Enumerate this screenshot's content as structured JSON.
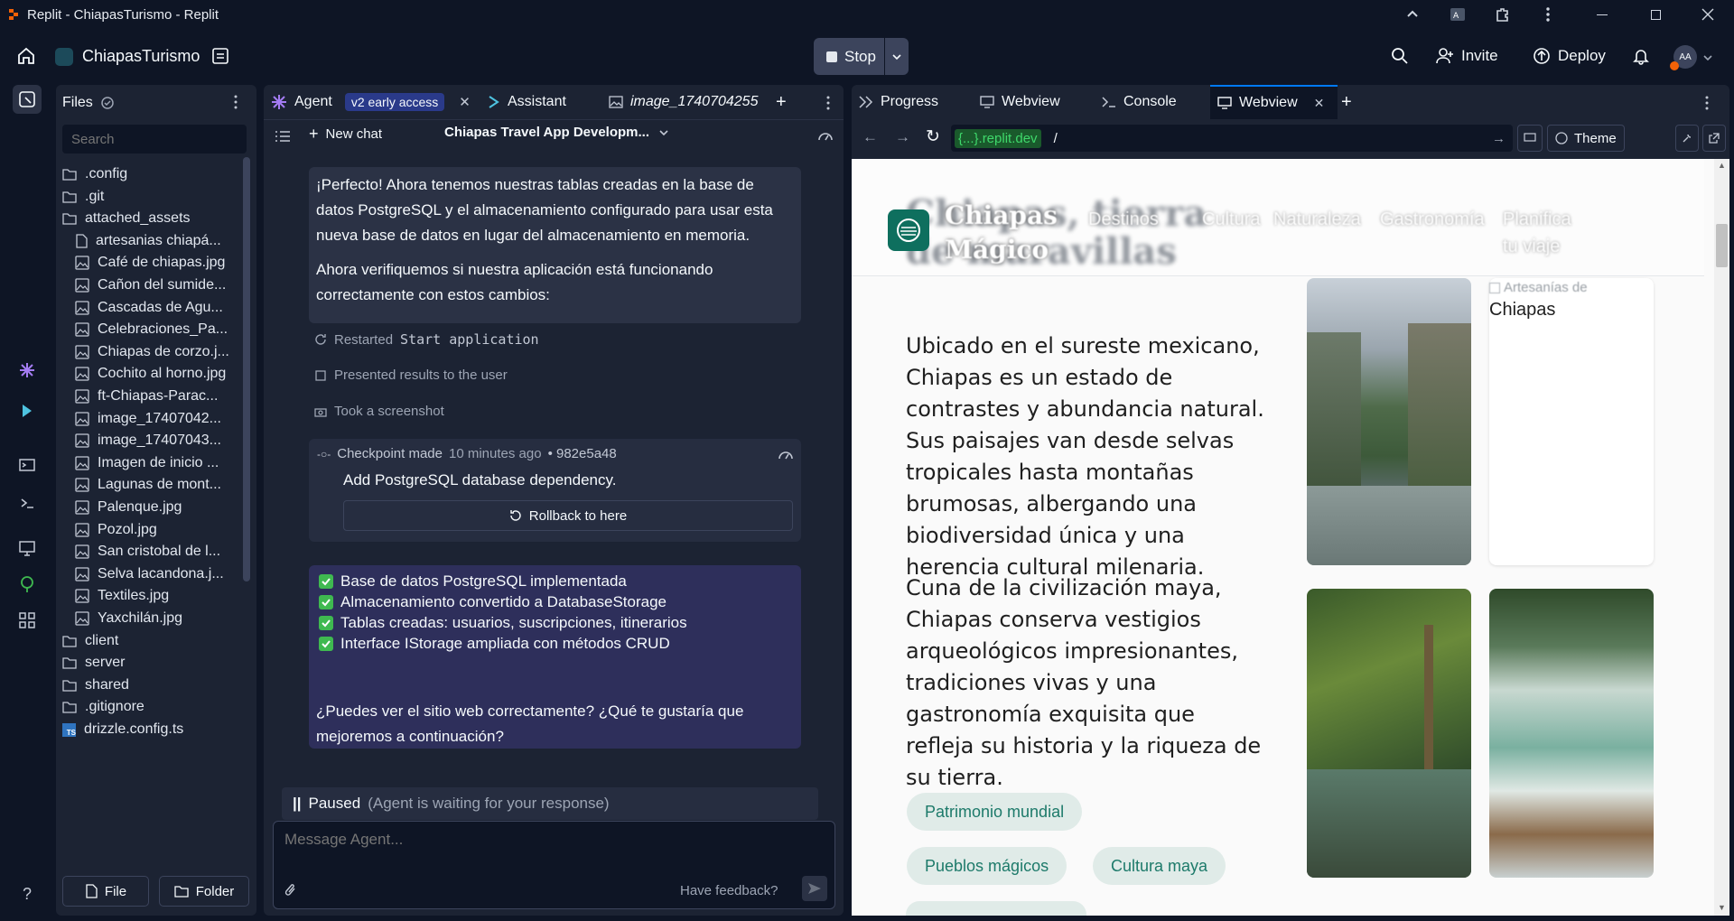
{
  "window": {
    "title": "Replit - ChiapasTurismo - Replit"
  },
  "topbar": {
    "project": "ChiapasTurismo",
    "stop": "Stop",
    "invite": "Invite",
    "deploy": "Deploy",
    "avatar": "AA"
  },
  "files": {
    "title": "Files",
    "search_placeholder": "Search",
    "items": [
      {
        "name": ".config",
        "type": "folder"
      },
      {
        "name": ".git",
        "type": "folder"
      },
      {
        "name": "attached_assets",
        "type": "folder-open"
      },
      {
        "name": "artesanias chiapá...",
        "type": "file"
      },
      {
        "name": "Café de chiapas.jpg",
        "type": "image"
      },
      {
        "name": "Cañon del sumide...",
        "type": "image"
      },
      {
        "name": "Cascadas de Agu...",
        "type": "image"
      },
      {
        "name": "Celebraciones_Pa...",
        "type": "image"
      },
      {
        "name": "Chiapas de corzo.j...",
        "type": "image"
      },
      {
        "name": "Cochito al horno.jpg",
        "type": "image"
      },
      {
        "name": "ft-Chiapas-Parac...",
        "type": "image"
      },
      {
        "name": "image_17407042...",
        "type": "image"
      },
      {
        "name": "image_17407043...",
        "type": "image"
      },
      {
        "name": "Imagen de inicio ...",
        "type": "image"
      },
      {
        "name": "Lagunas de mont...",
        "type": "image"
      },
      {
        "name": "Palenque.jpg",
        "type": "image"
      },
      {
        "name": "Pozol.jpg",
        "type": "image"
      },
      {
        "name": "San cristobal de l...",
        "type": "image"
      },
      {
        "name": "Selva lacandona.j...",
        "type": "image"
      },
      {
        "name": "Textiles.jpg",
        "type": "image"
      },
      {
        "name": "Yaxchilán.jpg",
        "type": "image"
      },
      {
        "name": "client",
        "type": "folder"
      },
      {
        "name": "server",
        "type": "folder"
      },
      {
        "name": "shared",
        "type": "folder"
      },
      {
        "name": ".gitignore",
        "type": "folder"
      },
      {
        "name": "drizzle.config.ts",
        "type": "ts"
      }
    ],
    "new_file": "File",
    "new_folder": "Folder"
  },
  "agent": {
    "tab_agent": "Agent",
    "badge": "v2 early access",
    "tab_assistant": "Assistant",
    "tab_image": "image_1740704255",
    "new_chat": "New chat",
    "chat_title": "Chiapas Travel App Developm...",
    "msg1": "¡Perfecto! Ahora tenemos nuestras tablas creadas en la base de datos PostgreSQL y el almacenamiento configurado para usar esta nueva base de datos en lugar del almacenamiento en memoria.",
    "msg2": "Ahora verifiquemos si nuestra aplicación está funcionando correctamente con estos cambios:",
    "act1_prefix": "Restarted",
    "act1_code": "Start application",
    "act2": "Presented results to the user",
    "act3": "Took a screenshot",
    "checkpoint_label": "Checkpoint made",
    "checkpoint_time": "10 minutes ago",
    "checkpoint_hash": "• 982e5a48",
    "checkpoint_desc": "Add PostgreSQL database dependency.",
    "rollback": "Rollback to here",
    "checks": [
      "Base de datos PostgreSQL implementada",
      "Almacenamiento convertido a DatabaseStorage",
      "Tablas creadas: usuarios, suscripciones, itinerarios",
      "Interface IStorage ampliada con métodos CRUD"
    ],
    "question": "¿Puedes ver el sitio web correctamente? ¿Qué te gustaría que mejoremos a continuación?",
    "paused": "Paused",
    "paused_note": "(Agent is waiting for your response)",
    "input_placeholder": "Message Agent...",
    "feedback": "Have feedback?"
  },
  "right": {
    "tabs": [
      "Progress",
      "Webview",
      "Console",
      "Webview"
    ],
    "url_host": "{...}.replit.dev",
    "url_path": "/",
    "theme": "Theme"
  },
  "site": {
    "brand": "Chiapas Mágico",
    "nav": [
      "Destinos",
      "Cultura",
      "Naturaleza",
      "Gastronomía",
      "Planifica tu viaje"
    ],
    "hero_blur": "Chiapas, tierra de maravillas",
    "p1": "Ubicado en el sureste mexicano, Chiapas es un estado de contrastes y abundancia natural. Sus paisajes van desde selvas tropicales hasta montañas brumosas, albergando una biodiversidad única y una herencia cultural milenaria.",
    "p2": "Cuna de la civilización maya, Chiapas conserva vestigios arqueológicos impresionantes, tradiciones vivas y una gastronomía exquisita que refleja su historia y la riqueza de su tierra.",
    "chips": [
      "Patrimonio mundial",
      "Pueblos mágicos",
      "Cultura maya"
    ],
    "broken_img_alt": "Artesanías de",
    "broken_img_caption": "Chiapas"
  }
}
